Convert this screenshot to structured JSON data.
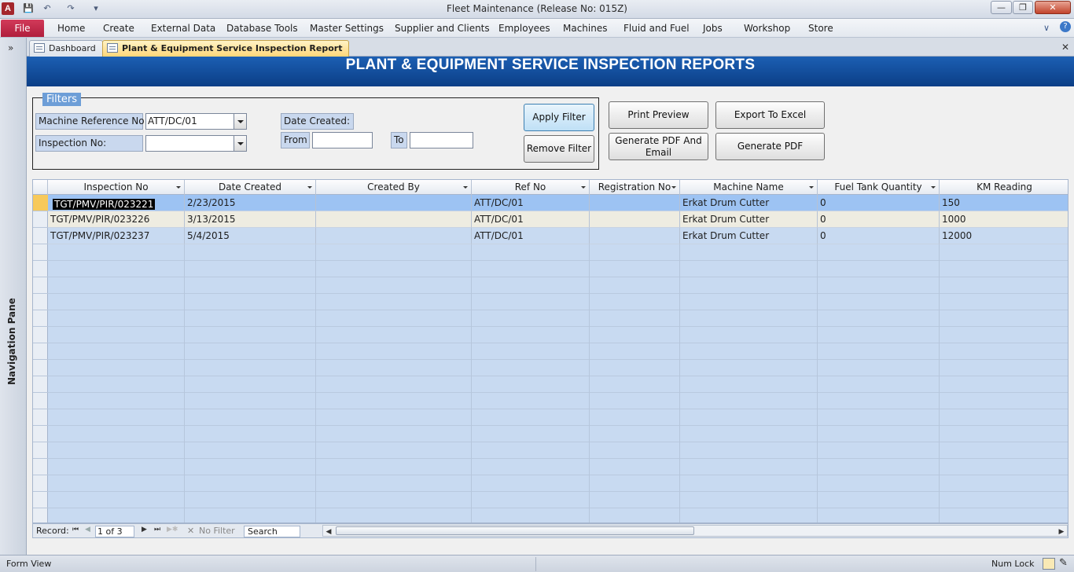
{
  "window": {
    "title": "Fleet Maintenance (Release No: 015Z)",
    "app_icon": "access-logo-icon",
    "min": "—",
    "max": "❐",
    "close": "✕"
  },
  "ribbon": {
    "file": "File",
    "tabs": [
      "Home",
      "Create",
      "External Data",
      "Database Tools",
      "Master Settings",
      "Supplier and Clients",
      "Employees",
      "Machines",
      "Fluid and Fuel",
      "Jobs",
      "Workshop",
      "Store"
    ]
  },
  "nav_pane": {
    "toggle": "»",
    "label": "Navigation Pane"
  },
  "doc_tabs": [
    "Dashboard",
    "Plant & Equipment Service Inspection Report"
  ],
  "header": {
    "title": "PLANT & EQUIPMENT SERVICE INSPECTION REPORTS"
  },
  "filters": {
    "legend": "Filters",
    "machine_ref_label": "Machine Reference No:",
    "machine_ref_value": "ATT/DC/01",
    "inspection_label": "Inspection No:",
    "inspection_value": "",
    "date_created_label": "Date Created:",
    "from_label": "From",
    "to_label": "To"
  },
  "buttons": {
    "apply": "Apply Filter",
    "remove": "Remove Filter",
    "print": "Print Preview",
    "export": "Export To Excel",
    "pdf_email": "Generate PDF And Email",
    "pdf": "Generate PDF"
  },
  "grid": {
    "columns": [
      "Inspection No",
      "Date Created",
      "Created By",
      "Ref No",
      "Registration No",
      "Machine Name",
      "Fuel Tank Quantity",
      "KM Reading"
    ],
    "rows": [
      [
        "TGT/PMV/PIR/023221",
        "2/23/2015",
        "",
        "ATT/DC/01",
        "",
        "Erkat Drum Cutter",
        "0",
        "150"
      ],
      [
        "TGT/PMV/PIR/023226",
        "3/13/2015",
        "",
        "ATT/DC/01",
        "",
        "Erkat Drum Cutter",
        "0",
        "1000"
      ],
      [
        "TGT/PMV/PIR/023237",
        "5/4/2015",
        "",
        "ATT/DC/01",
        "",
        "Erkat Drum Cutter",
        "0",
        "12000"
      ]
    ]
  },
  "record_nav": {
    "label": "Record:",
    "position": "1 of 3",
    "filter": "No Filter",
    "search": "Search"
  },
  "status": {
    "view": "Form View",
    "numlock": "Num Lock"
  }
}
